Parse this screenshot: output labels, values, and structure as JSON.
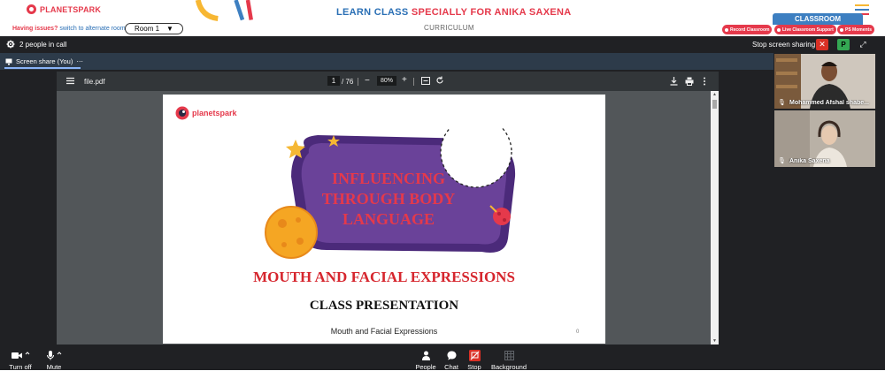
{
  "header": {
    "logo_text": "PLANETSPARK",
    "banner_part1": "LEARN CLASS ",
    "banner_part2": "SPECIALLY FOR ANIKA SAXENA",
    "issues_text": "Having issues?",
    "issues_link": "switch to alternate room",
    "room_value": "Room 1",
    "curriculum_label": "CURRICULUM",
    "classroom_tab": "CLASSROOM",
    "pills": [
      "Record Classroom",
      "Live Classroom Support",
      "PS Moments"
    ],
    "colors": {
      "brand_red": "#e5394b",
      "brand_blue": "#2a6fb5",
      "accent_yellow": "#f7b733"
    }
  },
  "meet": {
    "people_in_call": "2 people in call",
    "stop_sharing_label": "Stop screen sharing",
    "stop_icon": "close-icon",
    "presenter_badge": "P",
    "share_tab_label": "Screen share (You)",
    "share_tab_menu": "⋯"
  },
  "pdf": {
    "file_name": "file.pdf",
    "current_page": "1",
    "total_pages": "/ 76",
    "zoom": "80%",
    "zoom_minus": "−",
    "zoom_plus": "+",
    "slide": {
      "brand": "planetspark",
      "title_line1": "INFLUENCING",
      "title_line2": "THROUGH BODY",
      "title_line3": "LANGUAGE",
      "subtitle": "MOUTH AND FACIAL EXPRESSIONS",
      "heading": "CLASS PRESENTATION",
      "footer_text": "Mouth and Facial Expressions",
      "footer_num": "0"
    }
  },
  "participants": [
    {
      "name": "Mohammed Afshal shabe..."
    },
    {
      "name": "Anika Saxena"
    }
  ],
  "controls": {
    "turn_off": "Turn off",
    "mute": "Mute",
    "people": "People",
    "chat": "Chat",
    "stop": "Stop",
    "background": "Background"
  }
}
